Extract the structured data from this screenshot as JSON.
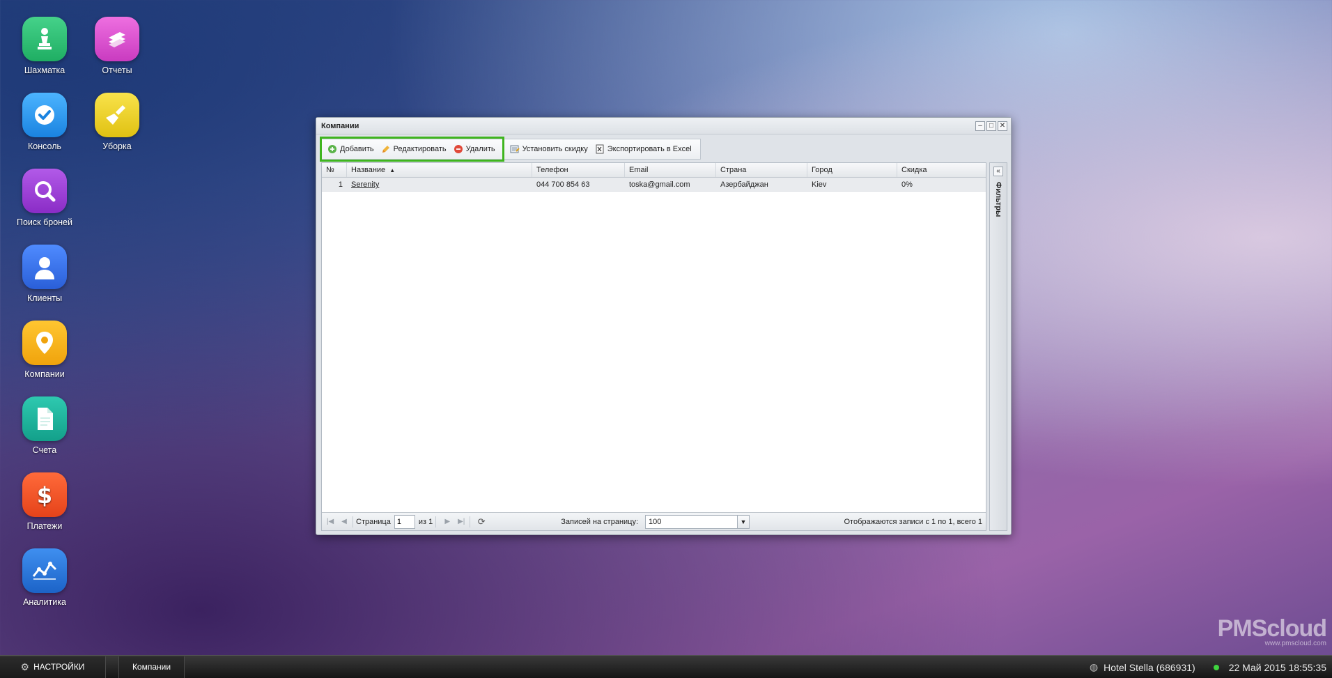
{
  "desktop": {
    "icons": [
      {
        "label": "Шахматка"
      },
      {
        "label": "Отчеты"
      },
      {
        "label": "Консоль"
      },
      {
        "label": "Уборка"
      },
      {
        "label": "Поиск броней"
      },
      {
        "label": "Клиенты"
      },
      {
        "label": "Компании"
      },
      {
        "label": "Счета"
      },
      {
        "label": "Платежи"
      },
      {
        "label": "Аналитика"
      }
    ]
  },
  "window": {
    "title": "Компании",
    "toolbar": {
      "add": "Добавить",
      "edit": "Редактировать",
      "delete": "Удалить",
      "set_discount": "Установить скидку",
      "export_excel": "Экспортировать в Excel"
    },
    "grid": {
      "columns": [
        "№",
        "Название",
        "Телефон",
        "Email",
        "Страна",
        "Город",
        "Скидка"
      ],
      "rows": [
        {
          "num": "1",
          "name": "Serenity",
          "phone": "044 700 854 63",
          "email": "toska@gmail.com",
          "country": "Азербайджан",
          "city": "Kiev",
          "discount": "0%"
        }
      ]
    },
    "pager": {
      "page_label": "Страница",
      "page_value": "1",
      "of_label": "из 1",
      "per_page_label": "Записей на страницу:",
      "per_page_value": "100",
      "summary": "Отображаются записи с 1 по 1, всего 1"
    },
    "filters_label": "Фильтры"
  },
  "taskbar": {
    "settings": "НАСТРОЙКИ",
    "open_window": "Компании",
    "hotel": "Hotel Stella (686931)",
    "datetime": "22 Май 2015 18:55:35",
    "status_color": "#3fd43f"
  },
  "watermark": {
    "brand": "PMScloud",
    "url": "www.pmscloud.com"
  }
}
